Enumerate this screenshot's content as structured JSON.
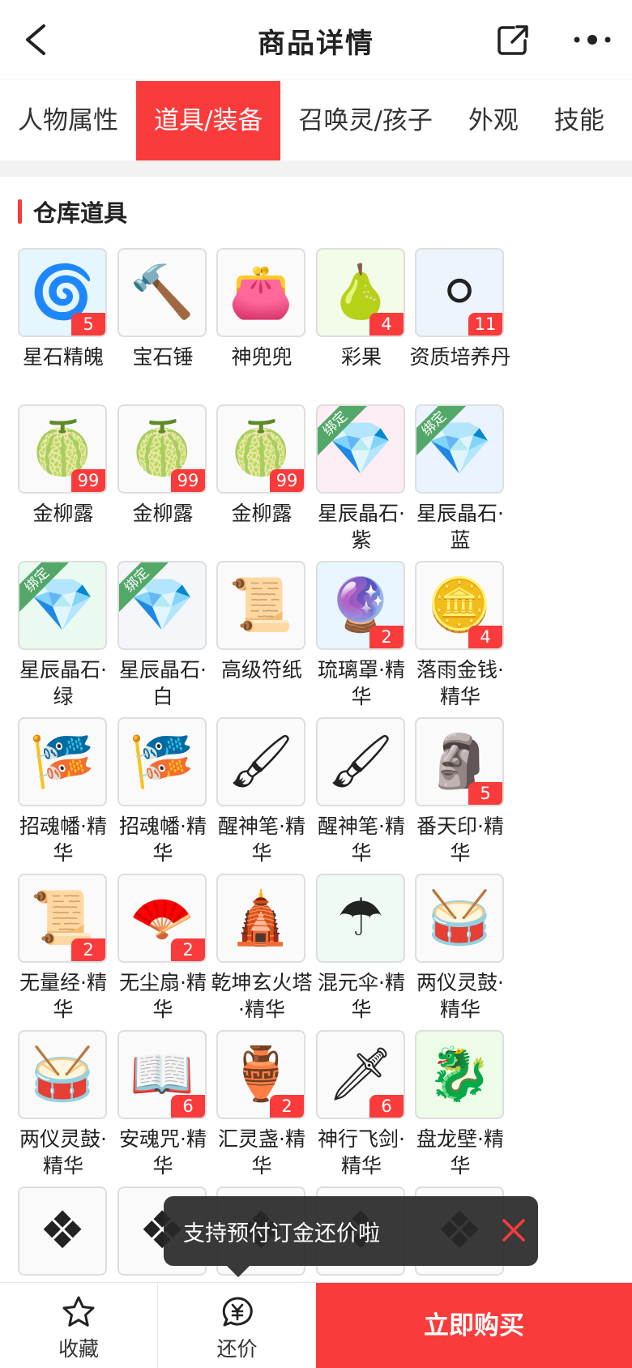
{
  "header": {
    "title": "商品详情",
    "back_icon": "back-arrow-icon",
    "share_icon": "share-icon",
    "more_icon": "more-icon"
  },
  "tabs": [
    {
      "label": "人物属性",
      "active": false
    },
    {
      "label": "道具/装备",
      "active": true
    },
    {
      "label": "召唤灵/孩子",
      "active": false
    },
    {
      "label": "外观",
      "active": false
    },
    {
      "label": "技能",
      "active": false
    }
  ],
  "section": {
    "title": "仓库道具"
  },
  "accent_color": "#f93b3b",
  "bound_label": "绑定",
  "items": [
    {
      "name": "星石精魄",
      "count": "5",
      "bound": false,
      "icon": "water-swirl-icon"
    },
    {
      "name": "宝石锤",
      "count": "",
      "bound": false,
      "icon": "hammer-icon"
    },
    {
      "name": "神兜兜",
      "count": "",
      "bound": false,
      "icon": "pouch-icon"
    },
    {
      "name": "彩果",
      "count": "4",
      "bound": false,
      "icon": "fruit-icon"
    },
    {
      "name": "资质培养丹",
      "count": "11",
      "bound": false,
      "icon": "pearl-icon"
    },
    {
      "name": "金柳露",
      "count": "99",
      "bound": false,
      "icon": "gourd-icon"
    },
    {
      "name": "金柳露",
      "count": "99",
      "bound": false,
      "icon": "gourd-icon"
    },
    {
      "name": "金柳露",
      "count": "99",
      "bound": false,
      "icon": "gourd-icon"
    },
    {
      "name": "星辰晶石·紫",
      "count": "",
      "bound": true,
      "icon": "crystal-purple-icon"
    },
    {
      "name": "星辰晶石·蓝",
      "count": "",
      "bound": true,
      "icon": "crystal-blue-icon"
    },
    {
      "name": "星辰晶石·绿",
      "count": "",
      "bound": true,
      "icon": "crystal-green-icon"
    },
    {
      "name": "星辰晶石·白",
      "count": "",
      "bound": true,
      "icon": "crystal-white-icon"
    },
    {
      "name": "高级符纸",
      "count": "",
      "bound": false,
      "icon": "talisman-paper-icon"
    },
    {
      "name": "琉璃罩·精华",
      "count": "2",
      "bound": false,
      "icon": "glaze-cover-icon"
    },
    {
      "name": "落雨金钱·精华",
      "count": "4",
      "bound": false,
      "icon": "gold-coin-icon"
    },
    {
      "name": "招魂幡·精华",
      "count": "",
      "bound": false,
      "icon": "banner-icon"
    },
    {
      "name": "招魂幡·精华",
      "count": "",
      "bound": false,
      "icon": "banner-icon"
    },
    {
      "name": "醒神笔·精华",
      "count": "",
      "bound": false,
      "icon": "brush-icon"
    },
    {
      "name": "醒神笔·精华",
      "count": "",
      "bound": false,
      "icon": "brush-icon"
    },
    {
      "name": "番天印·精华",
      "count": "5",
      "bound": false,
      "icon": "seal-icon"
    },
    {
      "name": "无量经·精华",
      "count": "2",
      "bound": false,
      "icon": "scroll-icon"
    },
    {
      "name": "无尘扇·精华",
      "count": "2",
      "bound": false,
      "icon": "fan-icon"
    },
    {
      "name": "乾坤玄火塔·精华",
      "count": "",
      "bound": false,
      "icon": "pagoda-icon"
    },
    {
      "name": "混元伞·精华",
      "count": "",
      "bound": false,
      "icon": "umbrella-icon"
    },
    {
      "name": "两仪灵鼓·精华",
      "count": "",
      "bound": false,
      "icon": "drum-icon"
    },
    {
      "name": "两仪灵鼓·精华",
      "count": "",
      "bound": false,
      "icon": "drum-icon"
    },
    {
      "name": "安魂咒·精华",
      "count": "6",
      "bound": false,
      "icon": "book-icon"
    },
    {
      "name": "汇灵盏·精华",
      "count": "2",
      "bound": false,
      "icon": "lamp-icon"
    },
    {
      "name": "神行飞剑·精华",
      "count": "6",
      "bound": false,
      "icon": "sword-icon"
    },
    {
      "name": "盘龙壁·精华",
      "count": "",
      "bound": false,
      "icon": "dragon-jade-icon"
    },
    {
      "name": "",
      "count": "",
      "bound": false,
      "icon": "item-icon"
    },
    {
      "name": "",
      "count": "",
      "bound": false,
      "icon": "item-icon"
    },
    {
      "name": "",
      "count": "",
      "bound": false,
      "icon": "item-icon"
    },
    {
      "name": "",
      "count": "",
      "bound": false,
      "icon": "item-icon"
    },
    {
      "name": "",
      "count": "",
      "bound": false,
      "icon": "item-icon"
    }
  ],
  "toast": {
    "message": "支持预付订金还价啦",
    "close_icon": "close-icon"
  },
  "bottom_bar": {
    "favorite_label": "收藏",
    "favorite_icon": "star-icon",
    "bargain_label": "还价",
    "bargain_icon": "yen-bubble-icon",
    "buy_label": "立即购买"
  }
}
